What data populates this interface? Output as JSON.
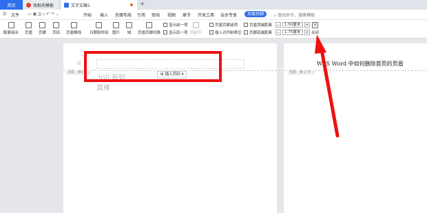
{
  "tabs": {
    "home": "首页",
    "template": "找稻壳模板",
    "document": "文字文稿1"
  },
  "menu": {
    "file": "文件",
    "items": [
      "开始",
      "插入",
      "页面布局",
      "引用",
      "审阅",
      "视图",
      "章节",
      "开发工具",
      "会员专享"
    ],
    "active": "页眉页脚",
    "search": "查找命令、搜索模板"
  },
  "toolbar": {
    "header_footer_combo": "配套组合",
    "header": "页眉",
    "footer": "页脚",
    "page_number": "页码",
    "header_line": "页眉横线",
    "date_time": "日期和时间",
    "picture": "图片",
    "field": "域",
    "switch_hf": "页眉页脚切换",
    "show_prev": "显示前一项",
    "show_next": "显示后一项",
    "same_as_prev": "同前节",
    "hf_options": "页眉页脚选项",
    "insert_align_tab": "插入对齐制表位",
    "header_top_dist": "页眉顶端距离",
    "footer_bottom_dist": "页脚底端距离",
    "header_val": "1.50厘米",
    "footer_val": "1.75厘米",
    "close": "关闭"
  },
  "page": {
    "header_tag": "页眉 - 第1节 -",
    "watermark_line1": "360 新知",
    "watermark_line2": "真棒",
    "insert_page_number": "插入页码",
    "page2_tag": "页眉 - 第 2 节 -",
    "page2_title": "WPS Word 中如何删除首页的页眉"
  },
  "colors": {
    "accent": "#2f6fed",
    "annotation_red": "#ee1111"
  }
}
